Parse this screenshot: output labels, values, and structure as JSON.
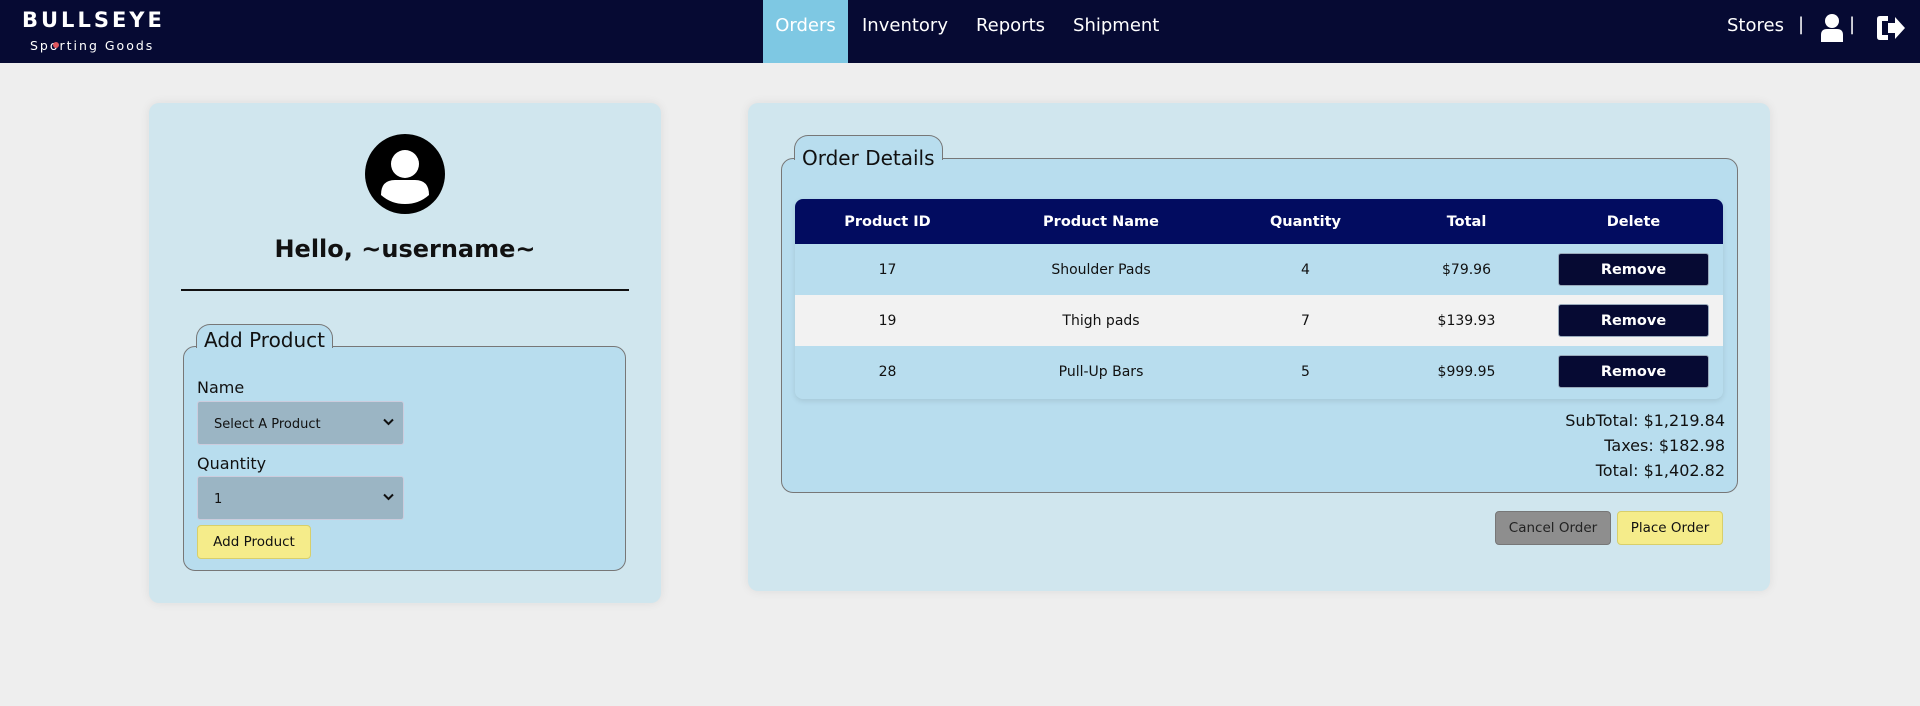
{
  "brand": {
    "name": "BULLSEYE",
    "tagline": "Sporting Goods"
  },
  "nav": {
    "links": [
      "Orders",
      "Inventory",
      "Reports",
      "Shipment"
    ],
    "active": "Orders",
    "stores": "Stores",
    "separator": "|"
  },
  "profile": {
    "greeting": "Hello, ~username~"
  },
  "add_product": {
    "title": "Add Product",
    "name_label": "Name",
    "name_value": "Select A Product",
    "quantity_label": "Quantity",
    "quantity_value": "1",
    "button": "Add Product"
  },
  "order": {
    "title": "Order Details",
    "columns": [
      "Product ID",
      "Product Name",
      "Quantity",
      "Total",
      "Delete"
    ],
    "rows": [
      {
        "id": "17",
        "name": "Shoulder Pads",
        "qty": "4",
        "total": "$79.96",
        "action": "Remove"
      },
      {
        "id": "19",
        "name": "Thigh pads",
        "qty": "7",
        "total": "$139.93",
        "action": "Remove"
      },
      {
        "id": "28",
        "name": "Pull-Up Bars",
        "qty": "5",
        "total": "$999.95",
        "action": "Remove"
      }
    ],
    "subtotal": "SubTotal: $1,219.84",
    "taxes": "Taxes: $182.98",
    "total": "Total: $1,402.82",
    "cancel": "Cancel Order",
    "place": "Place Order"
  },
  "colors": {
    "nav_bg": "#060a33",
    "active_tab": "#7ec8e3",
    "table_header": "#020c60",
    "yellow_button": "#f5ec8a"
  },
  "icons": [
    "user-icon",
    "logout-icon",
    "avatar-icon",
    "chevron-down-icon"
  ]
}
